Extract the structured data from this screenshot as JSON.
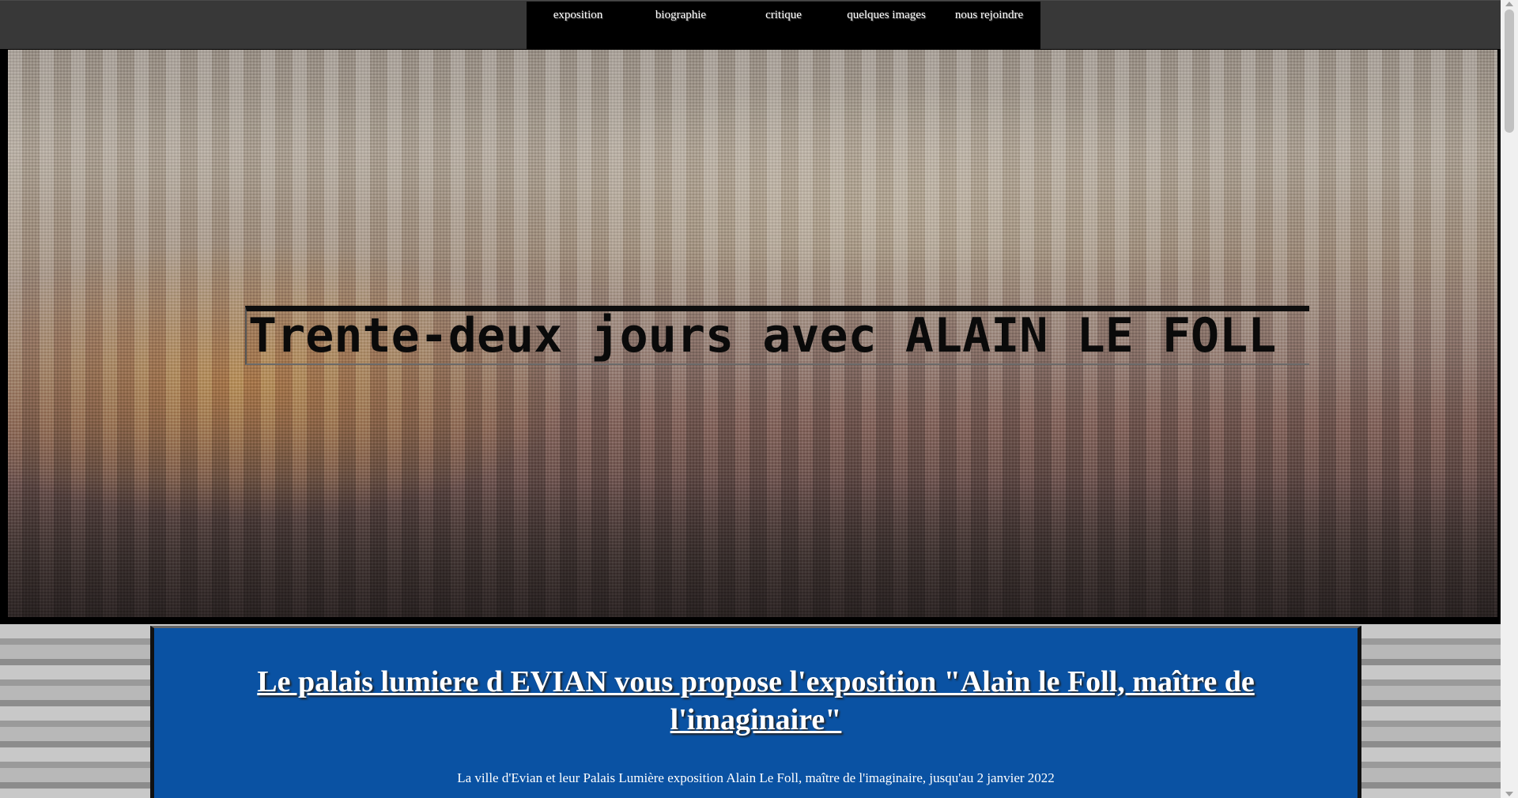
{
  "nav": {
    "items": [
      {
        "label": "exposition"
      },
      {
        "label": "biographie"
      },
      {
        "label": "critique"
      },
      {
        "label": "quelques images"
      },
      {
        "label": "nous rejoindre"
      }
    ]
  },
  "hero": {
    "title": "Trente-deux jours avec ALAIN LE FOLL"
  },
  "panel": {
    "heading": "Le palais lumiere d EVIAN vous propose l'exposition \"Alain le Foll, maître de l'imaginaire\"",
    "text": "La ville d'Evian et leur Palais Lumière exposition Alain Le Foll, maître de l'imaginaire, jusqu'au 2 janvier 2022"
  }
}
